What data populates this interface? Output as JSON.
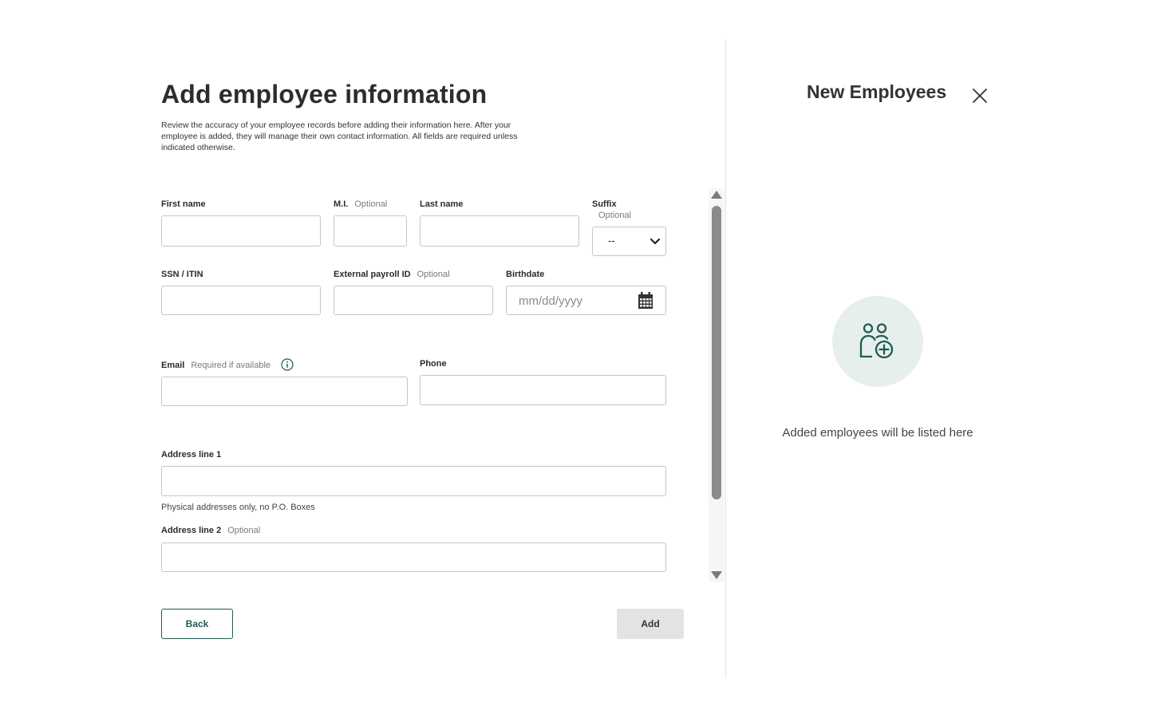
{
  "form": {
    "title": "Add employee information",
    "intro": "Review the accuracy of your employee records before adding their information here. After your employee is added, they will manage their own contact information. All fields are required unless indicated otherwise.",
    "first_name_label": "First name",
    "mi_label": "M.I.",
    "mi_optional": "Optional",
    "last_name_label": "Last name",
    "suffix_label": "Suffix",
    "suffix_optional": "Optional",
    "suffix_value": "--",
    "ssn_label": "SSN / ITIN",
    "external_id_label": "External payroll ID",
    "external_id_optional": "Optional",
    "birthdate_label": "Birthdate",
    "birthdate_placeholder": "mm/dd/yyyy",
    "email_label": "Email",
    "email_note": "Required if available",
    "phone_label": "Phone",
    "address1_label": "Address line 1",
    "address1_hint": "Physical addresses only, no P.O. Boxes",
    "address2_label": "Address line 2",
    "address2_optional": "Optional",
    "back_label": "Back",
    "add_label": "Add"
  },
  "panel": {
    "title": "New Employees",
    "empty_text": "Added employees will be listed here"
  },
  "colors": {
    "accent": "#1e5b52",
    "icon_circle_bg": "#e6efec",
    "add_button_bg": "#e3e3e3"
  },
  "icons": {
    "close": "close-icon",
    "calendar": "calendar-icon",
    "info": "info-icon",
    "add_people": "add-people-icon"
  }
}
